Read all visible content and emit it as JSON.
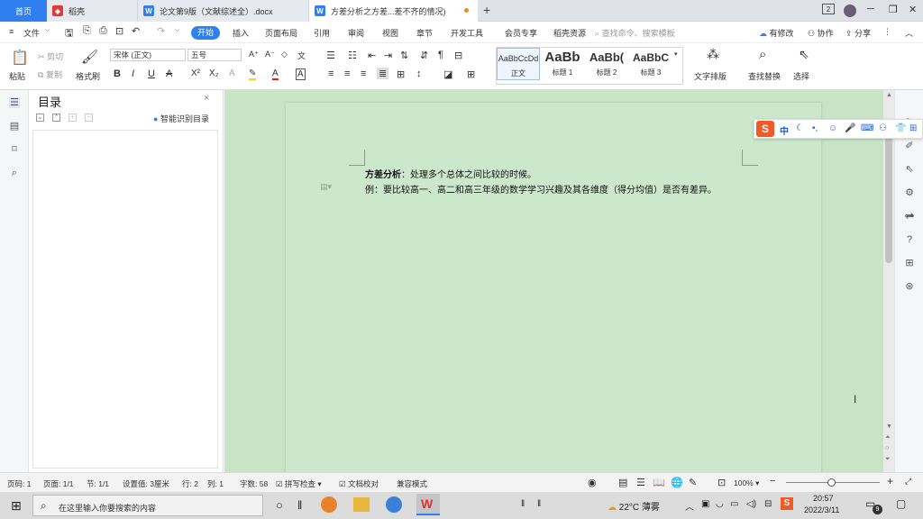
{
  "tabs": {
    "home": "首页",
    "daoke": "稻壳",
    "doc1": "论文第9版（文献综述全）.docx",
    "doc2": "方差分析之方差...差不齐的情况)",
    "add": "+",
    "badge": "2"
  },
  "menu": {
    "file": "文件",
    "start": "开始",
    "items": [
      "插入",
      "页面布局",
      "引用",
      "审阅",
      "视图",
      "章节",
      "开发工具",
      "会员专享",
      "稻壳资源"
    ],
    "search": "查找命令、搜索模板",
    "modified": "有修改",
    "collab": "协作",
    "share": "分享"
  },
  "ribbon": {
    "paste": "粘贴",
    "cut": "剪切",
    "copy": "复制",
    "format_painter": "格式刷",
    "font": "宋体 (正文)",
    "size": "五号",
    "styles": [
      {
        "preview": "AaBbCcDd",
        "label": "正文"
      },
      {
        "preview": "AaBb",
        "label": "标题 1"
      },
      {
        "preview": "AaBb(",
        "label": "标题 2"
      },
      {
        "preview": "AaBbC",
        "label": "标题 3"
      }
    ],
    "text_layout": "文字排版",
    "find_replace": "查找替换",
    "select": "选择"
  },
  "toc": {
    "title": "目录",
    "smart": "智能识别目录"
  },
  "document": {
    "line1_bold": "方差分析",
    "line1_rest": "：处理多个总体之间比较的时候。",
    "line2": "例：要比较高一、高二和高三年级的数学学习兴趣及其各维度（得分均值）是否有差异。"
  },
  "status": {
    "page": "页码: 1",
    "pages": "页面: 1/1",
    "section": "节: 1/1",
    "setting": "设置值: 3厘米",
    "row": "行: 2",
    "col": "列: 1",
    "words": "字数: 58",
    "spell": "拼写检查",
    "proof": "文档校对",
    "compat": "兼容模式",
    "zoom": "100%"
  },
  "taskbar": {
    "search_placeholder": "在这里输入你要搜索的内容",
    "weather": "22°C 薄雾",
    "time": "20:57",
    "date": "2022/3/11",
    "notif": "9"
  }
}
